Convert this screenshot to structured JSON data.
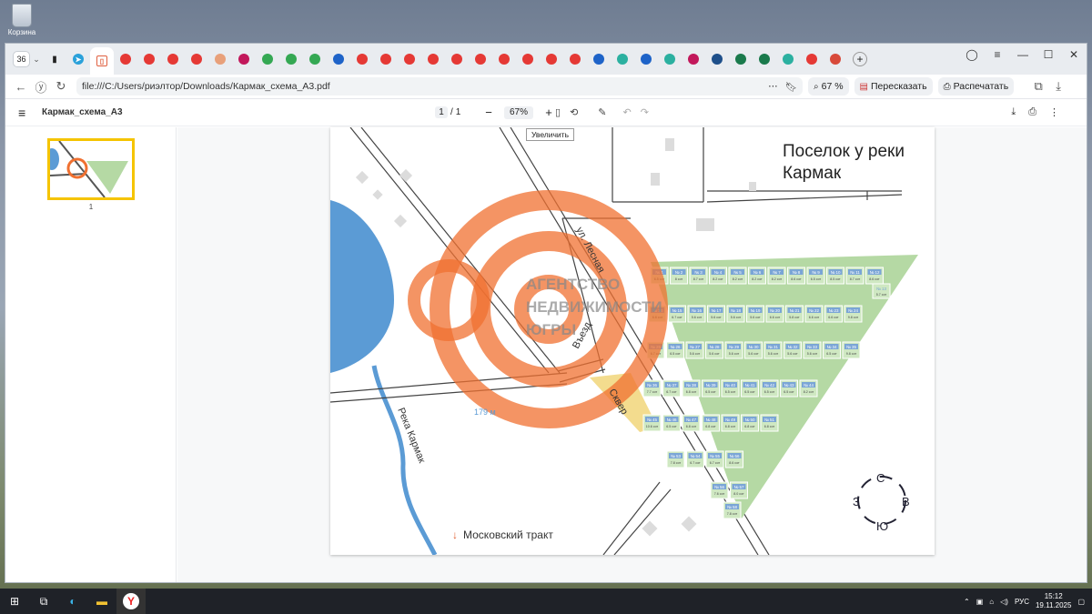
{
  "desktop": {
    "recycle_label": "Корзина"
  },
  "tabs": {
    "count": "36"
  },
  "window": {
    "minimize": "—",
    "maximize": "☐",
    "close": "✕"
  },
  "address": {
    "url": "file:///C:/Users/риэлтор/Downloads/Кармак_схема_А3.pdf",
    "zoom": "67 %",
    "retell": "Пересказать",
    "print": "Распечатать"
  },
  "pdf": {
    "file_title": "Кармак_схема_А3",
    "page_current": "1",
    "page_sep": "/",
    "page_total": "1",
    "zoom_value": "67%",
    "tooltip": "Увеличить",
    "thumb_page": "1"
  },
  "map": {
    "title_line1": "Поселок у реки",
    "title_line2": "Кармак",
    "street_lesnaya": "ул. Лесная",
    "entrance": "Въезд",
    "square": "Сквер",
    "river": "Река Кармак",
    "distance": "179 м",
    "road": "Московский тракт",
    "watermark_line1": "АГЕНТСТВО",
    "watermark_line2": "НЕДВИЖИМОСТИ",
    "watermark_line3": "ЮГРЫ",
    "compass": {
      "n": "С",
      "s": "Ю",
      "w": "З",
      "e": "В"
    },
    "colors": {
      "plots": "#b5d9a4",
      "plot_label": "#7aa5d6",
      "water": "#5b9bd5",
      "watermark": "#f07030",
      "square": "#f3dc8e"
    },
    "rows": [
      {
        "nums": [
          "1",
          "2",
          "3",
          "4",
          "5",
          "6",
          "7",
          "8",
          "9",
          "10",
          "11",
          "12"
        ],
        "areas": [
          "6.5 сот",
          "8 сот",
          "8.7 сот",
          "8.2 сот",
          "8.2 сот",
          "8.2 сот",
          "8.2 сот",
          "8.6 сот",
          "6.5 сот",
          "8.5 сот",
          "8.7 сот",
          "8.6 сот"
        ]
      },
      {
        "nums": [
          "14",
          "15",
          "16",
          "17",
          "18",
          "19",
          "20",
          "21",
          "22",
          "23",
          "24"
        ],
        "areas": [
          "6.8 сот",
          "6.7 сот",
          "5.6 сот",
          "5.6 сот",
          "5.6 сот",
          "5.6 сот",
          "6.6 сот",
          "5.8 сот",
          "6.6 сот",
          "6.6 сот",
          "9.8 сот"
        ]
      },
      {
        "nums": [
          "25",
          "26",
          "27",
          "28",
          "29",
          "30",
          "31",
          "32",
          "33",
          "34",
          "35"
        ],
        "areas": [
          "6.7 сот",
          "6.5 сот",
          "5.6 сот",
          "5.6 сот",
          "5.6 сот",
          "5.6 сот",
          "5.6 сот",
          "5.6 сот",
          "5.6 сот",
          "6.5 сот",
          "9.8 сот"
        ]
      },
      {
        "nums": [
          "36",
          "37",
          "38",
          "39",
          "40",
          "41",
          "42",
          "43",
          "44"
        ],
        "areas": [
          "7.7 сот",
          "6.7 сот",
          "6.8 сот",
          "6.5 сот",
          "6.5 сот",
          "6.5 сот",
          "6.5 сот",
          "6.5 сот",
          "8.2 сот"
        ]
      },
      {
        "nums": [
          "45",
          "46",
          "47",
          "48",
          "49",
          "50",
          "51"
        ],
        "areas": [
          "10.6 сот",
          "6.5 сот",
          "6.8 сот",
          "6.8 сот",
          "6.8 сот",
          "6.8 сот",
          "6.8 сот"
        ]
      },
      {
        "nums": [
          "53",
          "54",
          "55",
          "56"
        ],
        "areas": [
          "7.8 сот",
          "6.7 сот",
          "6.7 сот",
          "8.6 сот"
        ]
      },
      {
        "nums": [
          "56",
          "57"
        ],
        "areas": [
          "7.6 сот",
          "8.0 сот"
        ]
      },
      {
        "nums": [
          "58"
        ],
        "areas": [
          "7.8 сот"
        ]
      }
    ],
    "extra": [
      {
        "num": "13",
        "area": "5.7 сот"
      }
    ]
  },
  "taskbar": {
    "lang": "РУС",
    "time": "15:12",
    "date": "19.11.2025"
  }
}
